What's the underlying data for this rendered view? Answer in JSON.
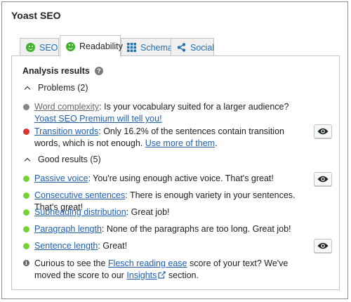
{
  "panel": {
    "title": "Yoast SEO"
  },
  "tabs": [
    {
      "label": "SEO",
      "icon": "smiley-icon"
    },
    {
      "label": "Readability",
      "icon": "smiley-icon"
    },
    {
      "label": "Schema",
      "icon": "grid-icon"
    },
    {
      "label": "Social",
      "icon": "share-icon"
    }
  ],
  "analysis": {
    "title": "Analysis results",
    "help_glyph": "?",
    "problems": {
      "label": "Problems (2)",
      "items": [
        {
          "link": "Word complexity",
          "text": ": Is your vocabulary suited for a larger audience? ",
          "cta": "Yoast SEO Premium will tell you!",
          "color": "#888888"
        },
        {
          "link": "Transition words",
          "text": ": Only 16.2% of the sentences contain transition words, which is not enough. ",
          "cta": "Use more of them",
          "tail": ".",
          "color": "#dc3232"
        }
      ]
    },
    "good": {
      "label": "Good results (5)",
      "items": [
        {
          "link": "Passive voice",
          "text": ": You're using enough active voice. That's great!",
          "color": "#7ad03a"
        },
        {
          "link": "Consecutive sentences",
          "text": ": There is enough variety in your sentences. That's great!",
          "color": "#7ad03a"
        },
        {
          "link": "Subheading distribution",
          "text": ": Great job!",
          "color": "#7ad03a"
        },
        {
          "link": "Paragraph length",
          "text": ": None of the paragraphs are too long. Great job!",
          "color": "#7ad03a"
        },
        {
          "link": "Sentence length",
          "text": ": Great!",
          "color": "#7ad03a"
        }
      ]
    },
    "note": {
      "pre": "Curious to see the ",
      "link": "Flesch reading ease",
      "mid": " score of your text? We've moved the score to our ",
      "link2": "Insights",
      "post": " section."
    }
  },
  "colors": {
    "accent": "#2271b1",
    "link": "#1f5fa8",
    "good": "#7ad03a",
    "bad": "#dc3232",
    "neutral": "#888888"
  }
}
